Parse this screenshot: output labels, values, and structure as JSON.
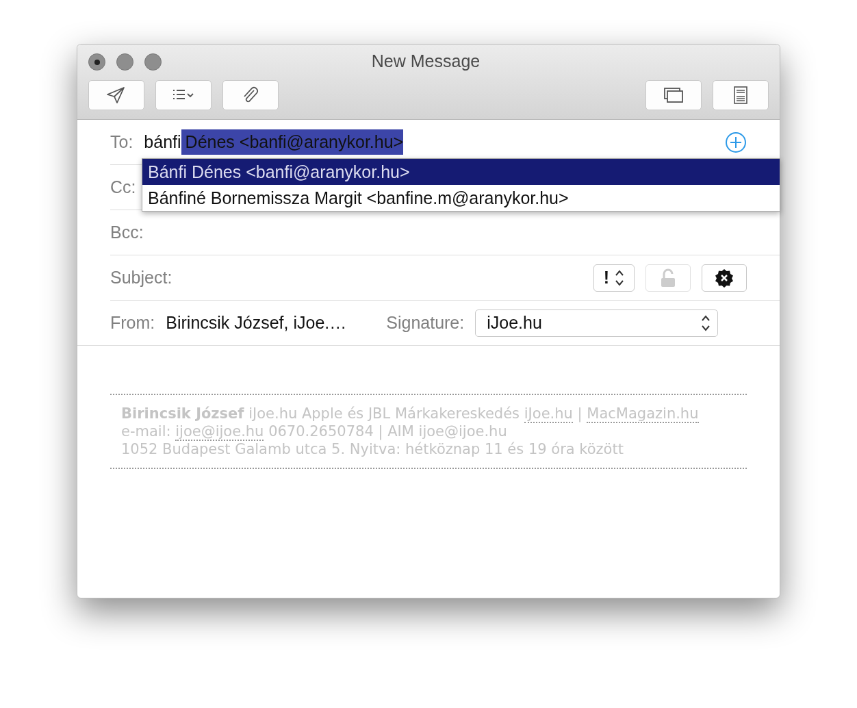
{
  "window": {
    "title": "New Message",
    "controls": [
      {
        "dot": true
      },
      {
        "dot": false
      },
      {
        "dot": false
      }
    ]
  },
  "toolbar": {
    "left": [
      {
        "kind": "send"
      },
      {
        "kind": "list"
      },
      {
        "kind": "attach"
      }
    ],
    "right": [
      {
        "kind": "windows"
      },
      {
        "kind": "format"
      }
    ]
  },
  "to": {
    "label": "To:",
    "typed": "bánfi",
    "completion": "Dénes <banfi@aranykor.hu>"
  },
  "suggestions": [
    {
      "text": "Bánfi Dénes <banfi@aranykor.hu>",
      "selected": true
    },
    {
      "text": "Bánfiné Bornemissza Margit <banfine.m@aranykor.hu>",
      "selected": false
    }
  ],
  "cc": {
    "label": "Cc:"
  },
  "bcc": {
    "label": "Bcc:"
  },
  "subject": {
    "label": "Subject:",
    "priority": "!"
  },
  "from": {
    "label": "From:",
    "value": "Birincsik József, iJoe.…"
  },
  "signature": {
    "label": "Signature:",
    "value": "iJoe.hu"
  },
  "signature_block": [
    [
      {
        "kind": "text",
        "text": "**Birincsik József** iJoe.hu Apple és JBL Márkakereskedés"
      },
      {
        "kind": "link",
        "text": "iJoe.hu"
      },
      {
        "kind": "text",
        "text": "|"
      },
      {
        "kind": "link",
        "text": "MacMagazin.hu"
      }
    ],
    [
      {
        "kind": "text",
        "text": "e-mail:"
      },
      {
        "kind": "link",
        "text": "ijoe@ijoe.hu"
      },
      {
        "kind": "text",
        "text": "0670.2650784 | AIM ijoe@ijoe.hu"
      }
    ],
    [
      {
        "kind": "text",
        "text": "1052 Budapest Galamb utca 5. Nyitva: hétköznap 11 és 19 óra között"
      }
    ]
  ]
}
